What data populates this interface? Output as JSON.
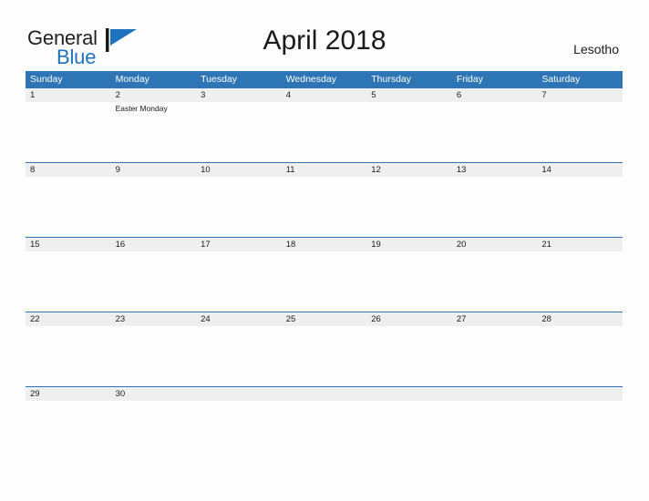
{
  "brand": {
    "word_one": "General",
    "word_two": "Blue",
    "flag_icon": "blue-flag-triangle-icon",
    "blue_hex": "#1f72bd"
  },
  "header": {
    "title": "April 2018",
    "region": "Lesotho"
  },
  "theme": {
    "header_blue": "#2e75b6",
    "date_band_gray": "#efefef",
    "page_background": "#fdfdfd",
    "text_dark": "#1a1a1a"
  },
  "calendar": {
    "month": "April",
    "year": "2018",
    "weekday_headers": [
      "Sunday",
      "Monday",
      "Tuesday",
      "Wednesday",
      "Thursday",
      "Friday",
      "Saturday"
    ],
    "weeks": [
      {
        "days": [
          {
            "date": "1",
            "event": ""
          },
          {
            "date": "2",
            "event": "Easter Monday"
          },
          {
            "date": "3",
            "event": ""
          },
          {
            "date": "4",
            "event": ""
          },
          {
            "date": "5",
            "event": ""
          },
          {
            "date": "6",
            "event": ""
          },
          {
            "date": "7",
            "event": ""
          }
        ]
      },
      {
        "days": [
          {
            "date": "8",
            "event": ""
          },
          {
            "date": "9",
            "event": ""
          },
          {
            "date": "10",
            "event": ""
          },
          {
            "date": "11",
            "event": ""
          },
          {
            "date": "12",
            "event": ""
          },
          {
            "date": "13",
            "event": ""
          },
          {
            "date": "14",
            "event": ""
          }
        ]
      },
      {
        "days": [
          {
            "date": "15",
            "event": ""
          },
          {
            "date": "16",
            "event": ""
          },
          {
            "date": "17",
            "event": ""
          },
          {
            "date": "18",
            "event": ""
          },
          {
            "date": "19",
            "event": ""
          },
          {
            "date": "20",
            "event": ""
          },
          {
            "date": "21",
            "event": ""
          }
        ]
      },
      {
        "days": [
          {
            "date": "22",
            "event": ""
          },
          {
            "date": "23",
            "event": ""
          },
          {
            "date": "24",
            "event": ""
          },
          {
            "date": "25",
            "event": ""
          },
          {
            "date": "26",
            "event": ""
          },
          {
            "date": "27",
            "event": ""
          },
          {
            "date": "28",
            "event": ""
          }
        ]
      },
      {
        "days": [
          {
            "date": "29",
            "event": ""
          },
          {
            "date": "30",
            "event": ""
          },
          {
            "date": "",
            "event": ""
          },
          {
            "date": "",
            "event": ""
          },
          {
            "date": "",
            "event": ""
          },
          {
            "date": "",
            "event": ""
          },
          {
            "date": "",
            "event": ""
          }
        ]
      }
    ]
  }
}
